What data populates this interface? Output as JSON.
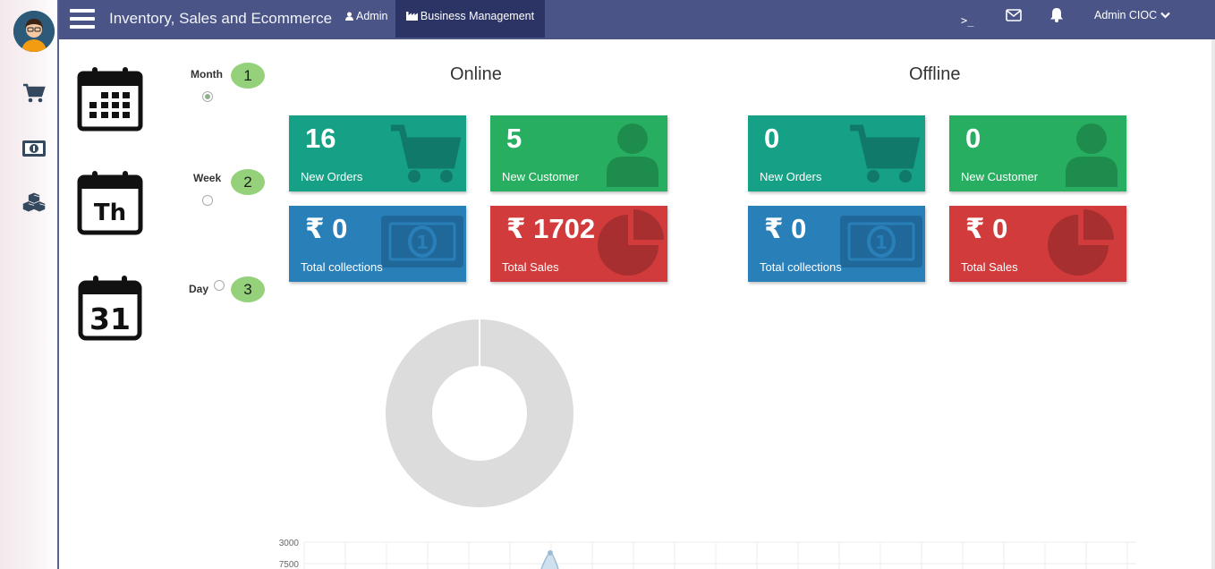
{
  "app": {
    "title": "Inventory, Sales and Ecommerce"
  },
  "nav": {
    "admin_label": "Admin",
    "business_label": "Business Management"
  },
  "topbar": {
    "console_glyph": ">_",
    "user_label": "Admin CIOC"
  },
  "rail": {
    "icons": [
      "cart-icon",
      "money-icon",
      "cubes-icon"
    ]
  },
  "period": {
    "calendar_day_text": "31",
    "calendar_week_text": "Th",
    "options": [
      {
        "label": "Month",
        "selected": true,
        "badge": "1"
      },
      {
        "label": "Week",
        "selected": false,
        "badge": "2"
      },
      {
        "label": "Day",
        "selected": false,
        "badge": "3"
      }
    ]
  },
  "online": {
    "title": "Online",
    "new_orders": {
      "value": "16",
      "label": "New Orders"
    },
    "new_customer": {
      "value": "5",
      "label": "New Customer"
    },
    "total_collections": {
      "value": "₹ 0",
      "label": "Total collections"
    },
    "total_sales": {
      "value": "₹ 1702",
      "label": "Total Sales"
    }
  },
  "offline": {
    "title": "Offline",
    "new_orders": {
      "value": "0",
      "label": "New Orders"
    },
    "new_customer": {
      "value": "0",
      "label": "New Customer"
    },
    "total_collections": {
      "value": "₹ 0",
      "label": "Total collections"
    },
    "total_sales": {
      "value": "₹ 0",
      "label": "Total Sales"
    }
  },
  "colors": {
    "topbar": "#4a5487",
    "teal": "#16a085",
    "green": "#27ae60",
    "blue": "#2980b9",
    "red": "#d13b3b",
    "badge": "#95d17a"
  },
  "chart_data": {
    "type": "line",
    "y_tick_labels": [
      "3000",
      "7500"
    ]
  }
}
